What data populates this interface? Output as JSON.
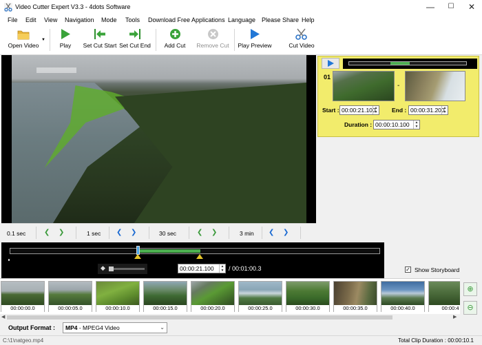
{
  "window": {
    "title": "Video Cutter Expert V3.3 - 4dots Software",
    "min": "—",
    "max": "☐",
    "close": "✕"
  },
  "menu": [
    "File",
    "Edit",
    "View",
    "Navigation",
    "Mode",
    "Tools",
    "Download Free Applications",
    "Language",
    "Please Share",
    "Help"
  ],
  "toolbar": {
    "open_video": "Open Video",
    "play": "Play",
    "set_cut_start": "Set Cut Start",
    "set_cut_end": "Set Cut End",
    "add_cut": "Add Cut",
    "remove_cut": "Remove Cut",
    "play_preview": "Play Preview",
    "cut_video": "Cut Video"
  },
  "segment": {
    "number": "01",
    "dash": "-",
    "start_label": "Start :",
    "start_value": "00:00:21.100",
    "end_label": "End :",
    "end_value": "00:00:31.200",
    "duration_label": "Duration :",
    "duration_value": "00:00:10.100"
  },
  "steps": [
    "0.1 sec",
    "1 sec",
    "30 sec",
    "3 min"
  ],
  "timeline": {
    "current": "00:00:21.100",
    "total": "/ 00:01:00.3"
  },
  "storyboard": {
    "label": "Show Storyboard",
    "checked": "✓"
  },
  "thumbnails": [
    "00:00:00.0",
    "00:00:05.0",
    "00:00:10.0",
    "00:00:15.0",
    "00:00:20.0",
    "00:00:25.0",
    "00:00:30.0",
    "00:00:35.0",
    "00:00:40.0",
    "00:00:4"
  ],
  "output": {
    "label": "Output Format :",
    "format_bold": "MP4",
    "format_rest": " - MPEG4 Video"
  },
  "status": {
    "file": "C:\\1\\natgeo.mp4",
    "total": "Total Clip Duration : 00:00:10.1"
  },
  "colors": {
    "segment_bg": "#f2ec6c",
    "cut_fill": "#4caf50",
    "marker": "#e6c52a"
  }
}
